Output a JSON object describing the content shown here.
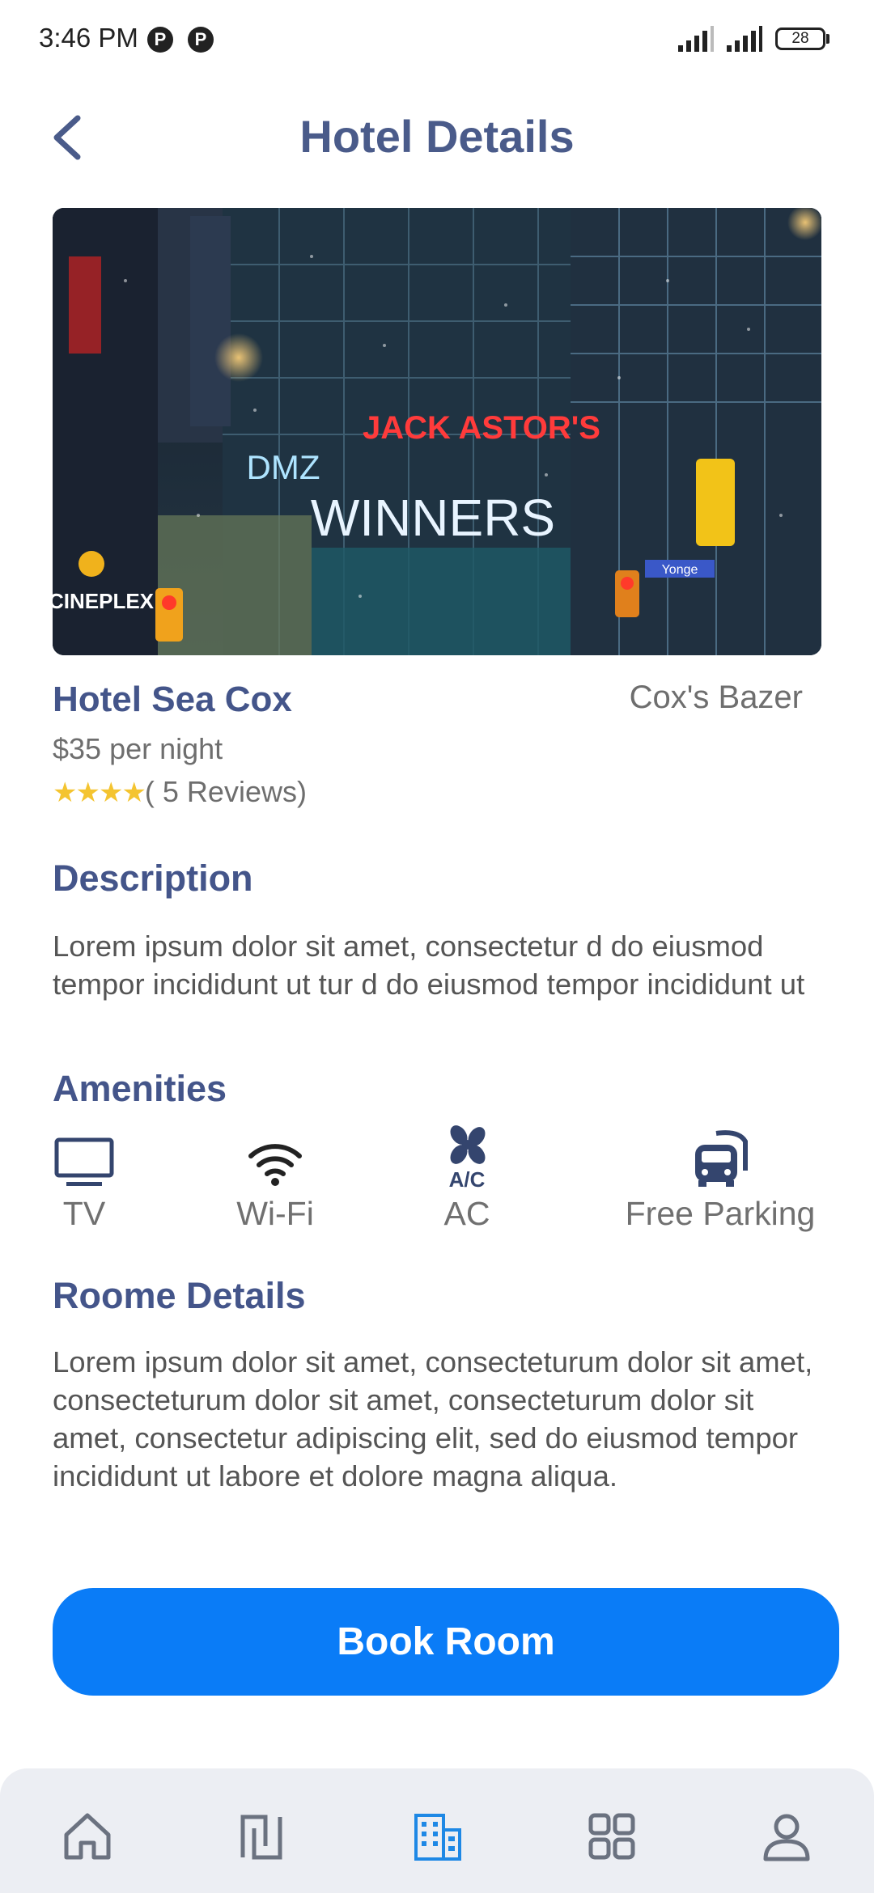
{
  "status_bar": {
    "time": "3:46 PM",
    "app_icons": [
      "P",
      "P"
    ],
    "battery": "28"
  },
  "header": {
    "title": "Hotel Details",
    "back_icon": "chevron-left-icon"
  },
  "hero_image": {
    "signs": [
      "JACK ASTOR'S",
      "WINNERS",
      "DMZ",
      "CINEPLEX",
      "Yonge"
    ]
  },
  "hotel": {
    "name": "Hotel Sea Cox",
    "location": "Cox's Bazer",
    "price": "$35 per night",
    "stars": "★★★★",
    "rating_count": 4,
    "reviews": "( 5 Reviews)"
  },
  "description": {
    "heading": "Description",
    "text": "Lorem ipsum dolor sit amet, consectetur d do eiusmod tempor incididunt ut tur d do eiusmod tempor incididunt ut"
  },
  "amenities": {
    "heading": "Amenities",
    "items": [
      {
        "label": "TV",
        "icon": "tv-icon"
      },
      {
        "label": "Wi-Fi",
        "icon": "wifi-icon"
      },
      {
        "label": "AC",
        "icon": "ac-icon"
      },
      {
        "label": "Free Parking",
        "icon": "bus-icon"
      }
    ]
  },
  "room_details": {
    "heading": "Roome Details",
    "text": "Lorem ipsum dolor sit amet, consecteturum dolor sit amet, consecteturum dolor sit amet, consecteturum dolor sit amet, consectetur adipiscing elit, sed do eiusmod tempor incididunt ut labore et dolore magna aliqua."
  },
  "book_button": {
    "label": "Book Room"
  },
  "bottom_nav": {
    "items": [
      "home-icon",
      "bookings-icon",
      "hotel-icon",
      "grid-icon",
      "profile-icon"
    ],
    "active": "hotel-icon"
  },
  "colors": {
    "heading": "#44558a",
    "accent": "#0a7cf7",
    "star": "#f4c430",
    "nav_active": "#1e88e5"
  }
}
